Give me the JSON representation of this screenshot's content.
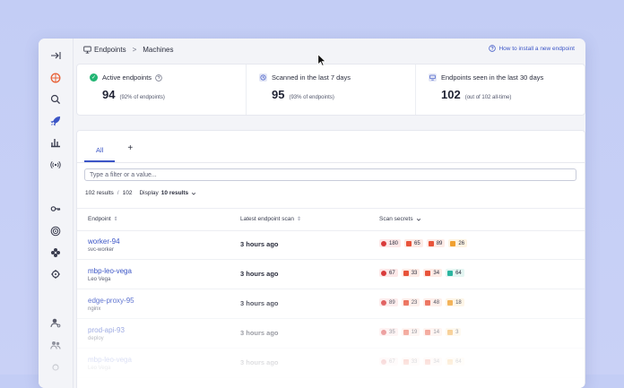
{
  "breadcrumb": {
    "section": "Endpoints",
    "page": "Machines",
    "sep": ">"
  },
  "help_link": "How to install a new endpoint",
  "stats": [
    {
      "icon": "check-circle-icon",
      "title": "Active endpoints",
      "value": "94",
      "sub": "(92% of endpoints)"
    },
    {
      "icon": "clock-icon",
      "title": "Scanned in the last 7 days",
      "value": "95",
      "sub": "(93% of endpoints)"
    },
    {
      "icon": "monitor-icon",
      "title": "Endpoints seen in the last 30 days",
      "value": "102",
      "sub": "(out of 102 all-time)"
    }
  ],
  "tabs": {
    "active": "All",
    "add": "+"
  },
  "filter_placeholder": "Type a filter or a value...",
  "results": {
    "count": "102 results",
    "sep": "/",
    "total": "102",
    "display_label": "Display",
    "display_value": "10 results"
  },
  "columns": {
    "endpoint": "Endpoint",
    "latest_scan": "Latest endpoint scan",
    "secrets": "Scan secrets"
  },
  "rows": [
    {
      "name": "worker-94",
      "sub": "svc-worker",
      "time": "3 hours ago",
      "secrets": [
        "180",
        "65",
        "89",
        "26"
      ]
    },
    {
      "name": "mbp-leo-vega",
      "sub": "Leo Vega",
      "time": "3 hours ago",
      "secrets": [
        "67",
        "33",
        "34",
        "64"
      ]
    },
    {
      "name": "edge-proxy-95",
      "sub": "nginx",
      "time": "3 hours ago",
      "secrets": [
        "89",
        "23",
        "48",
        "18"
      ]
    },
    {
      "name": "prod-api-93",
      "sub": "deploy",
      "time": "3 hours ago",
      "secrets": [
        "35",
        "19",
        "14",
        "3"
      ]
    },
    {
      "name": "mbp-leo-vega",
      "sub": "Leo Vega",
      "time": "3 hours ago",
      "secrets": [
        "67",
        "33",
        "34",
        "64"
      ]
    }
  ],
  "colors": {
    "accent": "#3b55c6",
    "critical": "#d93a3a",
    "high": "#e8533a",
    "medium": "#f0a030",
    "low": "#2bb5a0",
    "active": "#22b573"
  }
}
